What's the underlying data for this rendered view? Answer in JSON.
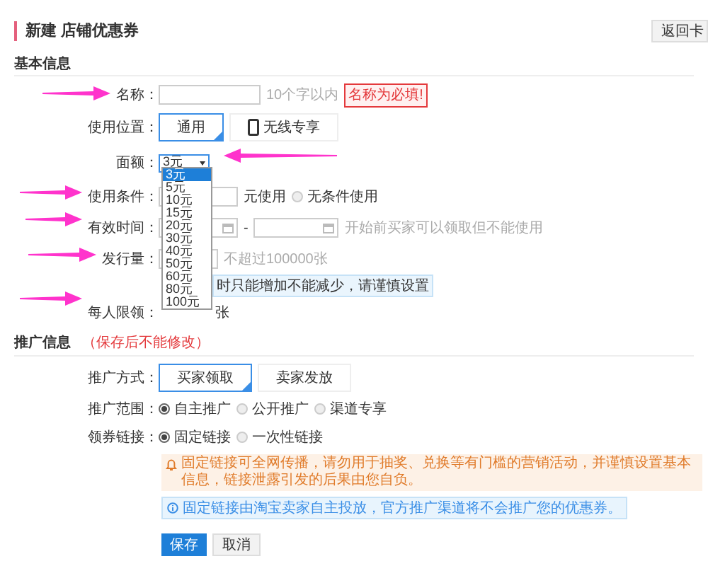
{
  "header": {
    "title": "新建 店铺优惠券",
    "back_button": "返回卡"
  },
  "basic_section": {
    "title": "基本信息"
  },
  "name_field": {
    "label": "名称：",
    "hint": "10个字以内",
    "error": "名称为必填!"
  },
  "location": {
    "label": "使用位置：",
    "options": [
      {
        "label": "通用",
        "selected": true,
        "kind": "text"
      },
      {
        "label": "无线专享",
        "selected": false,
        "kind": "mobile"
      }
    ]
  },
  "denomination": {
    "label": "面额：",
    "value": "3元",
    "options": [
      {
        "label": "3元",
        "selected": true
      },
      {
        "label": "5元",
        "selected": false
      },
      {
        "label": "10元",
        "selected": false
      },
      {
        "label": "15元",
        "selected": false
      },
      {
        "label": "20元",
        "selected": false
      },
      {
        "label": "30元",
        "selected": false
      },
      {
        "label": "40元",
        "selected": false
      },
      {
        "label": "50元",
        "selected": false
      },
      {
        "label": "60元",
        "selected": false
      },
      {
        "label": "80元",
        "selected": false
      },
      {
        "label": "100元",
        "selected": false
      }
    ]
  },
  "condition": {
    "label": "使用条件：",
    "unit": "元使用",
    "radio": {
      "label": "无条件使用",
      "checked": false
    }
  },
  "validity": {
    "label": "有效时间：",
    "separator": "-",
    "hint": "开始前买家可以领取但不能使用"
  },
  "quantity": {
    "label": "发行量：",
    "hint": "不超过100000张",
    "notice": "时只能增加不能减少，请谨慎设置"
  },
  "limit": {
    "label": "每人限领：",
    "unit": "张"
  },
  "promo_section": {
    "title": "推广信息",
    "note": "（保存后不能修改）"
  },
  "method": {
    "label": "推广方式：",
    "options": [
      {
        "label": "买家领取",
        "selected": true
      },
      {
        "label": "卖家发放",
        "selected": false
      }
    ]
  },
  "scope": {
    "label": "推广范围：",
    "options": [
      {
        "label": "自主推广",
        "selected": true
      },
      {
        "label": "公开推广",
        "selected": false
      },
      {
        "label": "渠道专享",
        "selected": false
      }
    ]
  },
  "link": {
    "label": "领券链接：",
    "options": [
      {
        "label": "固定链接",
        "selected": true
      },
      {
        "label": "一次性链接",
        "selected": false
      }
    ]
  },
  "warning": "固定链接可全网传播，请勿用于抽奖、兑换等有门槛的营销活动，并谨慎设置基本信息，链接泄露引发的后果由您自负。",
  "info": "固定链接由淘宝卖家自主投放，官方推广渠道将不会推广您的优惠券。",
  "buttons": [
    {
      "label": "保存",
      "kind": "primary"
    },
    {
      "label": "取消",
      "kind": "secondary"
    }
  ]
}
